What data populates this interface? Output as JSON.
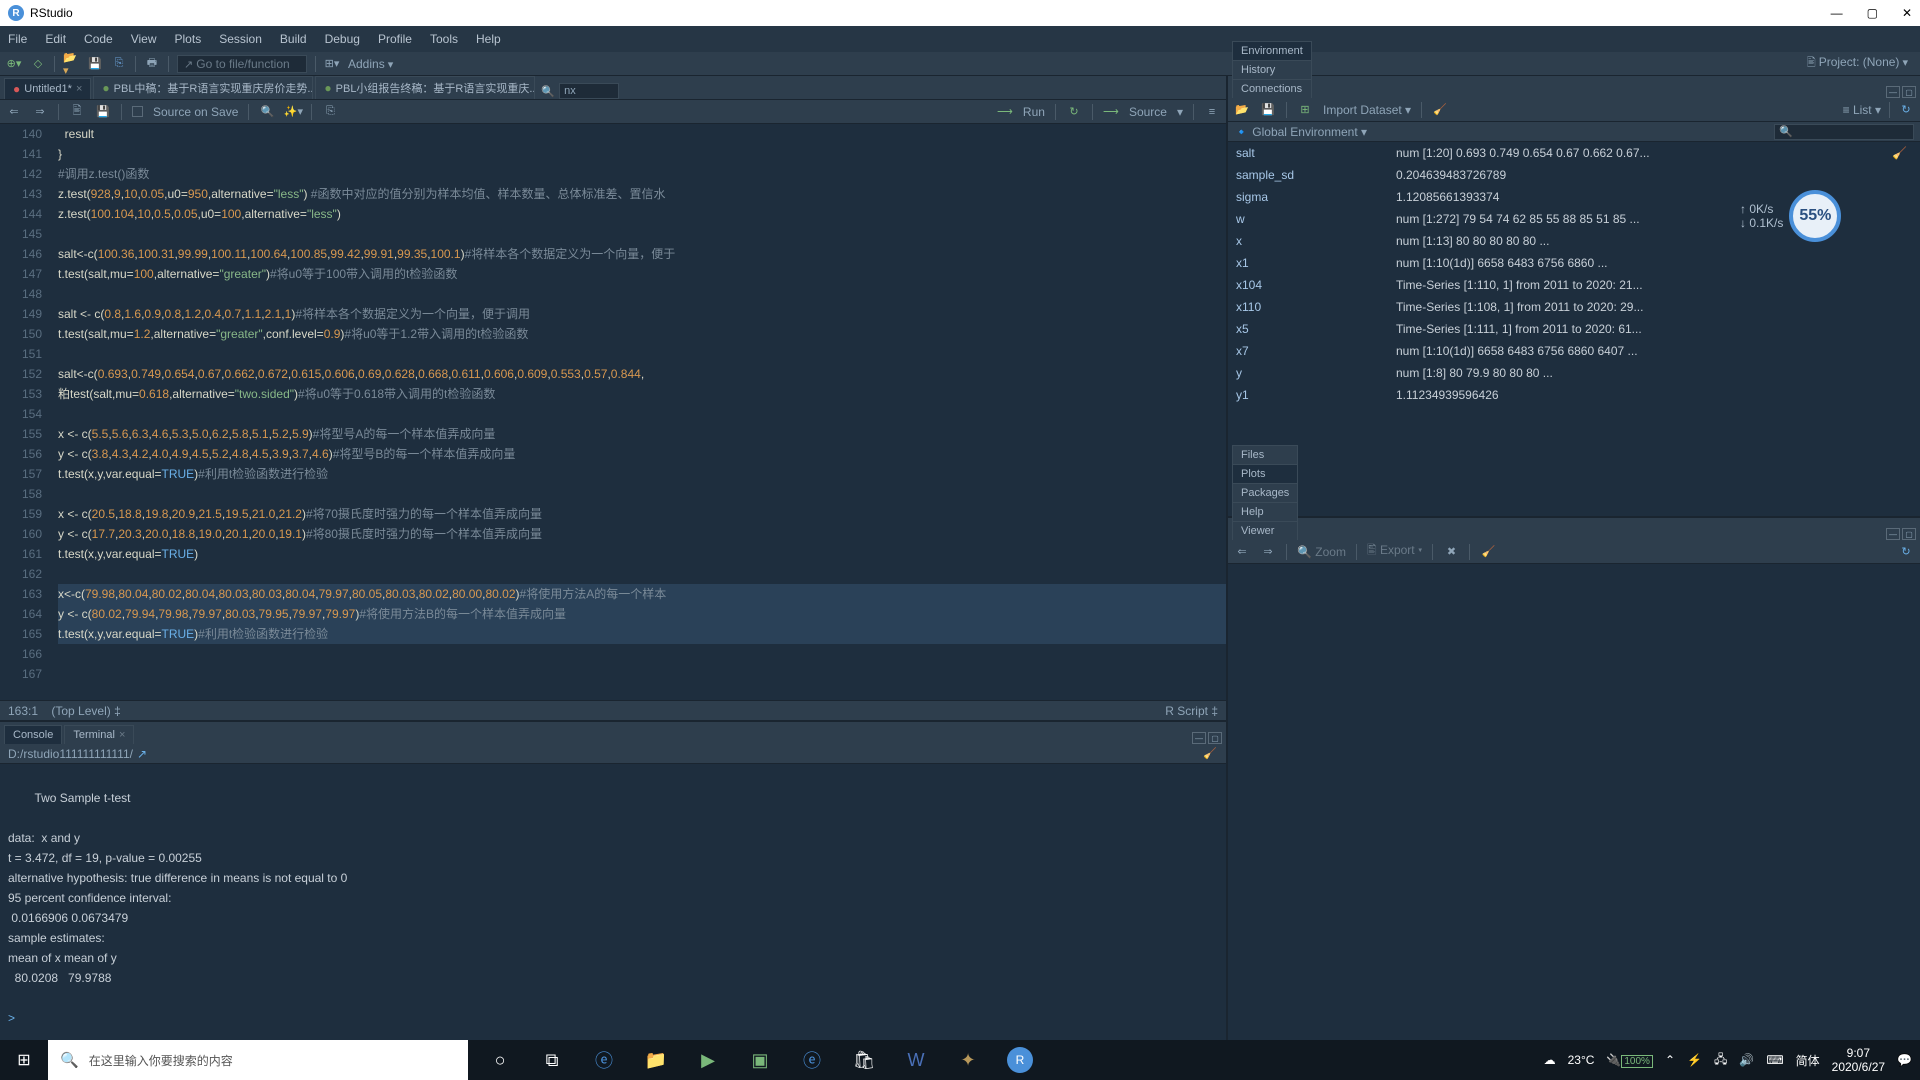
{
  "title": "RStudio",
  "menus": [
    "File",
    "Edit",
    "Code",
    "View",
    "Plots",
    "Session",
    "Build",
    "Debug",
    "Profile",
    "Tools",
    "Help"
  ],
  "toolbar": {
    "goto": "Go to file/function",
    "addins": "Addins",
    "project": "Project: (None)"
  },
  "src": {
    "tabs": [
      {
        "icon": "●",
        "label": "Untitled1*",
        "active": true
      },
      {
        "icon": "●",
        "label": "PBL中稿：基于R语言实现重庆房价走势...",
        "active": false
      },
      {
        "icon": "●",
        "label": "PBL小组报告终稿：基于R语言实现重庆...",
        "active": false
      }
    ],
    "find": "nx",
    "sourceonsave": "Source on Save",
    "run": "Run",
    "source": "Source",
    "status_pos": "163:1",
    "status_scope": "(Top Level)",
    "status_lang": "R Script"
  },
  "code": {
    "start": 140,
    "lines": [
      {
        "t": "  result",
        "cls": ""
      },
      {
        "t": "}",
        "cls": ""
      },
      {
        "t": "#调用z.test()函数",
        "cls": "cm"
      },
      {
        "raw": true,
        "html": "z.test(<span class='num'>928</span>,<span class='num'>9</span>,<span class='num'>10</span>,<span class='num'>0.05</span>,u0=<span class='num'>950</span>,alternative=<span class='str'>\"less\"</span>) <span class='cm'>#函数中对应的值分别为样本均值、样本数量、总体标准差、置信水</span>"
      },
      {
        "raw": true,
        "html": "z.test(<span class='num'>100.104</span>,<span class='num'>10</span>,<span class='num'>0.5</span>,<span class='num'>0.05</span>,u0=<span class='num'>100</span>,alternative=<span class='str'>\"less\"</span>)"
      },
      {
        "t": "",
        "cls": ""
      },
      {
        "raw": true,
        "html": "salt&lt;-c(<span class='num'>100.36</span>,<span class='num'>100.31</span>,<span class='num'>99.99</span>,<span class='num'>100.11</span>,<span class='num'>100.64</span>,<span class='num'>100.85</span>,<span class='num'>99.42</span>,<span class='num'>99.91</span>,<span class='num'>99.35</span>,<span class='num'>100.1</span>)<span class='cm'>#将样本各个数据定义为一个向量，便于</span>"
      },
      {
        "raw": true,
        "html": "t.test(salt,mu=<span class='num'>100</span>,alternative=<span class='str'>\"greater\"</span>)<span class='cm'>#将u0等于100带入调用的t检验函数</span>"
      },
      {
        "t": "",
        "cls": ""
      },
      {
        "raw": true,
        "html": "salt &lt;- c(<span class='num'>0.8</span>,<span class='num'>1.6</span>,<span class='num'>0.9</span>,<span class='num'>0.8</span>,<span class='num'>1.2</span>,<span class='num'>0.4</span>,<span class='num'>0.7</span>,<span class='num'>1.1</span>,<span class='num'>2.1</span>,<span class='num'>1</span>)<span class='cm'>#将样本各个数据定义为一个向量，便于调用</span>"
      },
      {
        "raw": true,
        "html": "t.test(salt,mu=<span class='num'>1.2</span>,alternative=<span class='str'>\"greater\"</span>,conf.level=<span class='num'>0.9</span>)<span class='cm'>#将u0等于1.2带入调用的t检验函数</span>"
      },
      {
        "t": "",
        "cls": ""
      },
      {
        "raw": true,
        "html": "salt&lt;-c(<span class='num'>0.693</span>,<span class='num'>0.749</span>,<span class='num'>0.654</span>,<span class='num'>0.67</span>,<span class='num'>0.662</span>,<span class='num'>0.672</span>,<span class='num'>0.615</span>,<span class='num'>0.606</span>,<span class='num'>0.69</span>,<span class='num'>0.628</span>,<span class='num'>0.668</span>,<span class='num'>0.611</span>,<span class='num'>0.606</span>,<span class='num'>0.609</span>,<span class='num'>0.553</span>,<span class='num'>0.57</span>,<span class='num'>0.844</span>,"
      },
      {
        "raw": true,
        "html": "粕test(salt,mu=<span class='num'>0.618</span>,alternative=<span class='str'>\"two.sided\"</span>)<span class='cm'>#将u0等于0.618带入调用的t检验函数</span>"
      },
      {
        "t": "",
        "cls": ""
      },
      {
        "raw": true,
        "html": "x &lt;- c(<span class='num'>5.5</span>,<span class='num'>5.6</span>,<span class='num'>6.3</span>,<span class='num'>4.6</span>,<span class='num'>5.3</span>,<span class='num'>5.0</span>,<span class='num'>6.2</span>,<span class='num'>5.8</span>,<span class='num'>5.1</span>,<span class='num'>5.2</span>,<span class='num'>5.9</span>)<span class='cm'>#将型号A的每一个样本值弄成向量</span>"
      },
      {
        "raw": true,
        "html": "y &lt;- c(<span class='num'>3.8</span>,<span class='num'>4.3</span>,<span class='num'>4.2</span>,<span class='num'>4.0</span>,<span class='num'>4.9</span>,<span class='num'>4.5</span>,<span class='num'>5.2</span>,<span class='num'>4.8</span>,<span class='num'>4.5</span>,<span class='num'>3.9</span>,<span class='num'>3.7</span>,<span class='num'>4.6</span>)<span class='cm'>#将型号B的每一个样本值弄成向量</span>"
      },
      {
        "raw": true,
        "html": "t.test(x,y,var.equal=<span class='kw'>TRUE</span>)<span class='cm'>#利用t检验函数进行检验</span>"
      },
      {
        "t": "",
        "cls": ""
      },
      {
        "raw": true,
        "html": "x &lt;- c(<span class='num'>20.5</span>,<span class='num'>18.8</span>,<span class='num'>19.8</span>,<span class='num'>20.9</span>,<span class='num'>21.5</span>,<span class='num'>19.5</span>,<span class='num'>21.0</span>,<span class='num'>21.2</span>)<span class='cm'>#将70摄氏度时强力的每一个样本值弄成向量</span>"
      },
      {
        "raw": true,
        "html": "y &lt;- c(<span class='num'>17.7</span>,<span class='num'>20.3</span>,<span class='num'>20.0</span>,<span class='num'>18.8</span>,<span class='num'>19.0</span>,<span class='num'>20.1</span>,<span class='num'>20.0</span>,<span class='num'>19.1</span>)<span class='cm'>#将80摄氏度时强力的每一个样本值弄成向量</span>"
      },
      {
        "raw": true,
        "html": "t.test(x,y,var.equal=<span class='kw'>TRUE</span>)"
      },
      {
        "t": "",
        "cls": ""
      },
      {
        "raw": true,
        "sel": true,
        "html": "x&lt;-c(<span class='num'>79.98</span>,<span class='num'>80.04</span>,<span class='num'>80.02</span>,<span class='num'>80.04</span>,<span class='num'>80.03</span>,<span class='num'>80.03</span>,<span class='num'>80.04</span>,<span class='num'>79.97</span>,<span class='num'>80.05</span>,<span class='num'>80.03</span>,<span class='num'>80.02</span>,<span class='num'>80.00</span>,<span class='num'>80.02</span>)<span class='cm'>#将使用方法A的每一个样本</span>"
      },
      {
        "raw": true,
        "sel": true,
        "html": "y &lt;- c(<span class='num'>80.02</span>,<span class='num'>79.94</span>,<span class='num'>79.98</span>,<span class='num'>79.97</span>,<span class='num'>80.03</span>,<span class='num'>79.95</span>,<span class='num'>79.97</span>,<span class='num'>79.97</span>)<span class='cm'>#将使用方法B的每一个样本值弄成向量</span>"
      },
      {
        "raw": true,
        "sel": true,
        "html": "t.test(x,y,var.equal=<span class='kw'>TRUE</span>)<span class='cm'>#利用t检验函数进行检验</span>"
      },
      {
        "t": "",
        "cls": ""
      },
      {
        "t": "",
        "cls": ""
      }
    ]
  },
  "console": {
    "tabs": [
      "Console",
      "Terminal"
    ],
    "path": "D:/rstudio111111111111/",
    "out": "\n        Two Sample t-test\n\ndata:  x and y\nt = 3.472, df = 19, p-value = 0.00255\nalternative hypothesis: true difference in means is not equal to 0\n95 percent confidence interval:\n 0.0166906 0.0673479\nsample estimates:\nmean of x mean of y \n  80.0208   79.9788 \n"
  },
  "env": {
    "tabs": [
      "Environment",
      "History",
      "Connections"
    ],
    "import": "Import Dataset",
    "list": "List",
    "scope": "Global Environment",
    "vars": [
      {
        "n": "salt",
        "v": "num [1:20] 0.693 0.749 0.654 0.67 0.662 0.67..."
      },
      {
        "n": "sample_sd",
        "v": "0.204639483726789"
      },
      {
        "n": "sigma",
        "v": "1.12085661393374"
      },
      {
        "n": "w",
        "v": "num [1:272] 79 54 74 62 85 55 88 85 51 85 ..."
      },
      {
        "n": "x",
        "v": "num [1:13] 80 80 80 80 80 ..."
      },
      {
        "n": "x1",
        "v": "num [1:10(1d)] 6658 6483 6756 6860 ..."
      },
      {
        "n": "x104",
        "v": "Time-Series [1:110, 1] from 2011 to 2020: 21..."
      },
      {
        "n": "x110",
        "v": "Time-Series [1:108, 1] from 2011 to 2020: 29..."
      },
      {
        "n": "x5",
        "v": "Time-Series [1:111, 1] from 2011 to 2020: 61..."
      },
      {
        "n": "x7",
        "v": "num [1:10(1d)] 6658 6483 6756 6860 6407 ..."
      },
      {
        "n": "y",
        "v": "num [1:8] 80 79.9 80 80 80 ..."
      },
      {
        "n": "y1",
        "v": "1.11234939596426"
      }
    ]
  },
  "viewer": {
    "tabs": [
      "Files",
      "Plots",
      "Packages",
      "Help",
      "Viewer"
    ],
    "active": "Plots",
    "zoom": "Zoom",
    "export": "Export"
  },
  "net": {
    "up": "0K/s",
    "down": "0.1K/s",
    "pct": "55%"
  },
  "tray": {
    "temp": "23°C",
    "batt": "100%",
    "ime": "简体",
    "time": "9:07",
    "date": "2020/6/27"
  },
  "search": "在这里输入你要搜索的内容"
}
